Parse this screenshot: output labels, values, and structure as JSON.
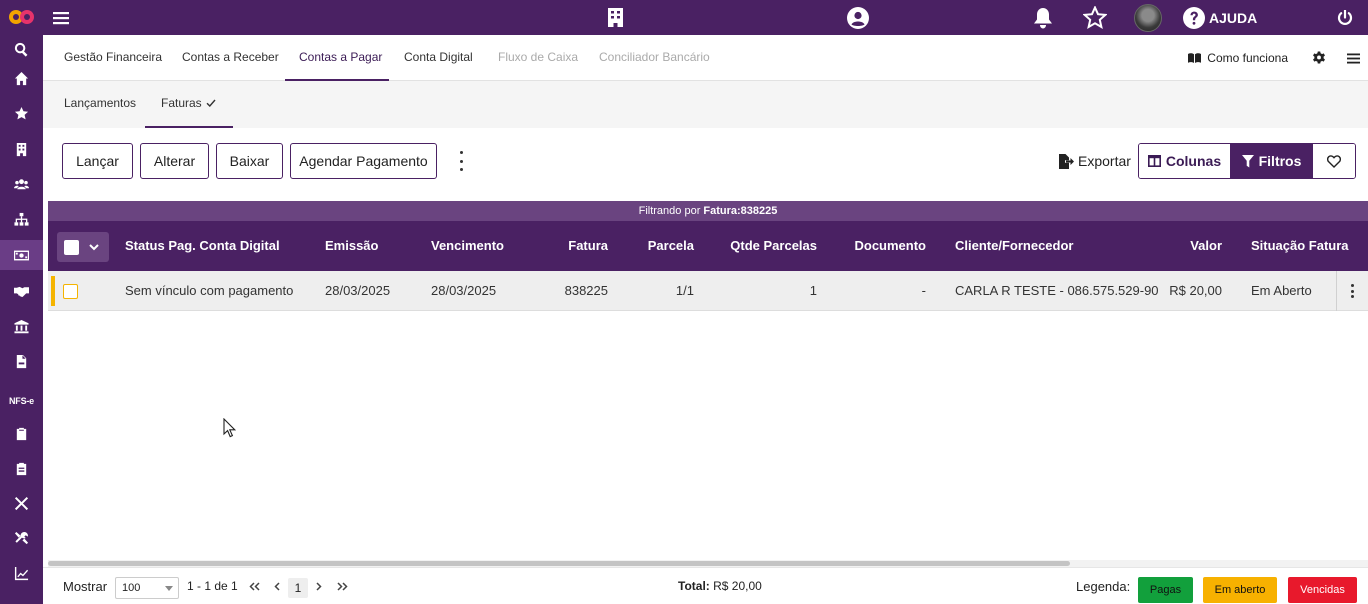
{
  "topbar": {
    "help_label": "AJUDA",
    "icons": [
      "menu-icon",
      "building-icon",
      "user-circle-icon",
      "bell-icon",
      "star-icon",
      "avatar",
      "help-icon",
      "power-icon"
    ]
  },
  "sidebar": {
    "items": [
      "search-icon",
      "home-icon",
      "star-icon",
      "building-icon",
      "users-icon",
      "sitemap-icon",
      "money-icon",
      "handshake-icon",
      "bank-icon",
      "file-invoice-icon",
      "nfse",
      "clipboard-icon",
      "clipboard-list-icon",
      "tools-icon",
      "wrench-icon",
      "chart-line-icon"
    ],
    "nfse_label": "NFS-e"
  },
  "tabs": {
    "items": [
      {
        "label": "Gestão Financeira"
      },
      {
        "label": "Contas a Receber"
      },
      {
        "label": "Contas a Pagar"
      },
      {
        "label": "Conta Digital"
      },
      {
        "label": "Fluxo de Caixa"
      },
      {
        "label": "Conciliador Bancário"
      }
    ],
    "active": "Contas a Pagar",
    "how_works": "Como funciona"
  },
  "subtabs": {
    "items": [
      {
        "label": "Lançamentos"
      },
      {
        "label": "Faturas"
      }
    ],
    "active": "Faturas"
  },
  "toolbar": {
    "buttons": [
      {
        "label": "Lançar"
      },
      {
        "label": "Alterar"
      },
      {
        "label": "Baixar"
      },
      {
        "label": "Agendar Pagamento"
      }
    ],
    "export_label": "Exportar",
    "columns_label": "Colunas",
    "filters_label": "Filtros"
  },
  "table": {
    "filter_prefix": "Filtrando por",
    "filter_value": "Fatura:838225",
    "columns": [
      "Status Pag. Conta Digital",
      "Emissão",
      "Vencimento",
      "Fatura",
      "Parcela",
      "Qtde Parcelas",
      "Documento",
      "Cliente/Fornecedor",
      "Valor",
      "Situação Fatura"
    ],
    "rows": [
      {
        "status": "Sem vínculo com pagamento",
        "emissao": "28/03/2025",
        "vencimento": "28/03/2025",
        "fatura": "838225",
        "parcela": "1/1",
        "qtde_parcelas": "1",
        "documento": "-",
        "cliente": "CARLA R TESTE - 086.575.529-90",
        "valor": "R$ 20,00",
        "situacao": "Em Aberto"
      }
    ]
  },
  "footer": {
    "show_label": "Mostrar",
    "page_size": "100",
    "range_text": "1 - 1 de 1",
    "current_page": "1",
    "total_label": "Total:",
    "total_value": "R$ 20,00",
    "legend_label": "Legenda:",
    "legend": [
      {
        "label": "Pagas",
        "color": "#12a03c"
      },
      {
        "label": "Em aberto",
        "color": "#f7b100"
      },
      {
        "label": "Vencidas",
        "color": "#e8192c"
      }
    ]
  },
  "colors": {
    "primary": "#4a2163",
    "primary_light": "#6a4480",
    "warning": "#f5b400"
  }
}
